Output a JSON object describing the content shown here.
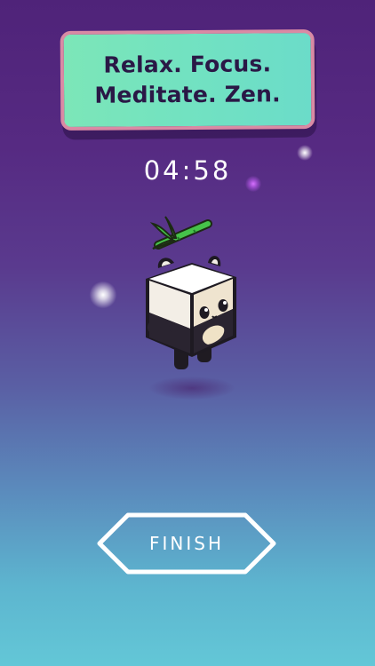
{
  "banner": {
    "line1": "Relax. Focus.",
    "line2": "Meditate. Zen."
  },
  "timer": {
    "display": "04:58"
  },
  "character": {
    "name": "panda-icon",
    "accessory": "bamboo-icon"
  },
  "actions": {
    "finish_label": "FINISH"
  },
  "colors": {
    "banner_fill": "#72e2c1",
    "banner_border": "#d98aa4",
    "banner_text": "#2a1846",
    "background_top": "#4f2379",
    "background_bottom": "#63c7d7",
    "button_outline": "#ffffff"
  }
}
